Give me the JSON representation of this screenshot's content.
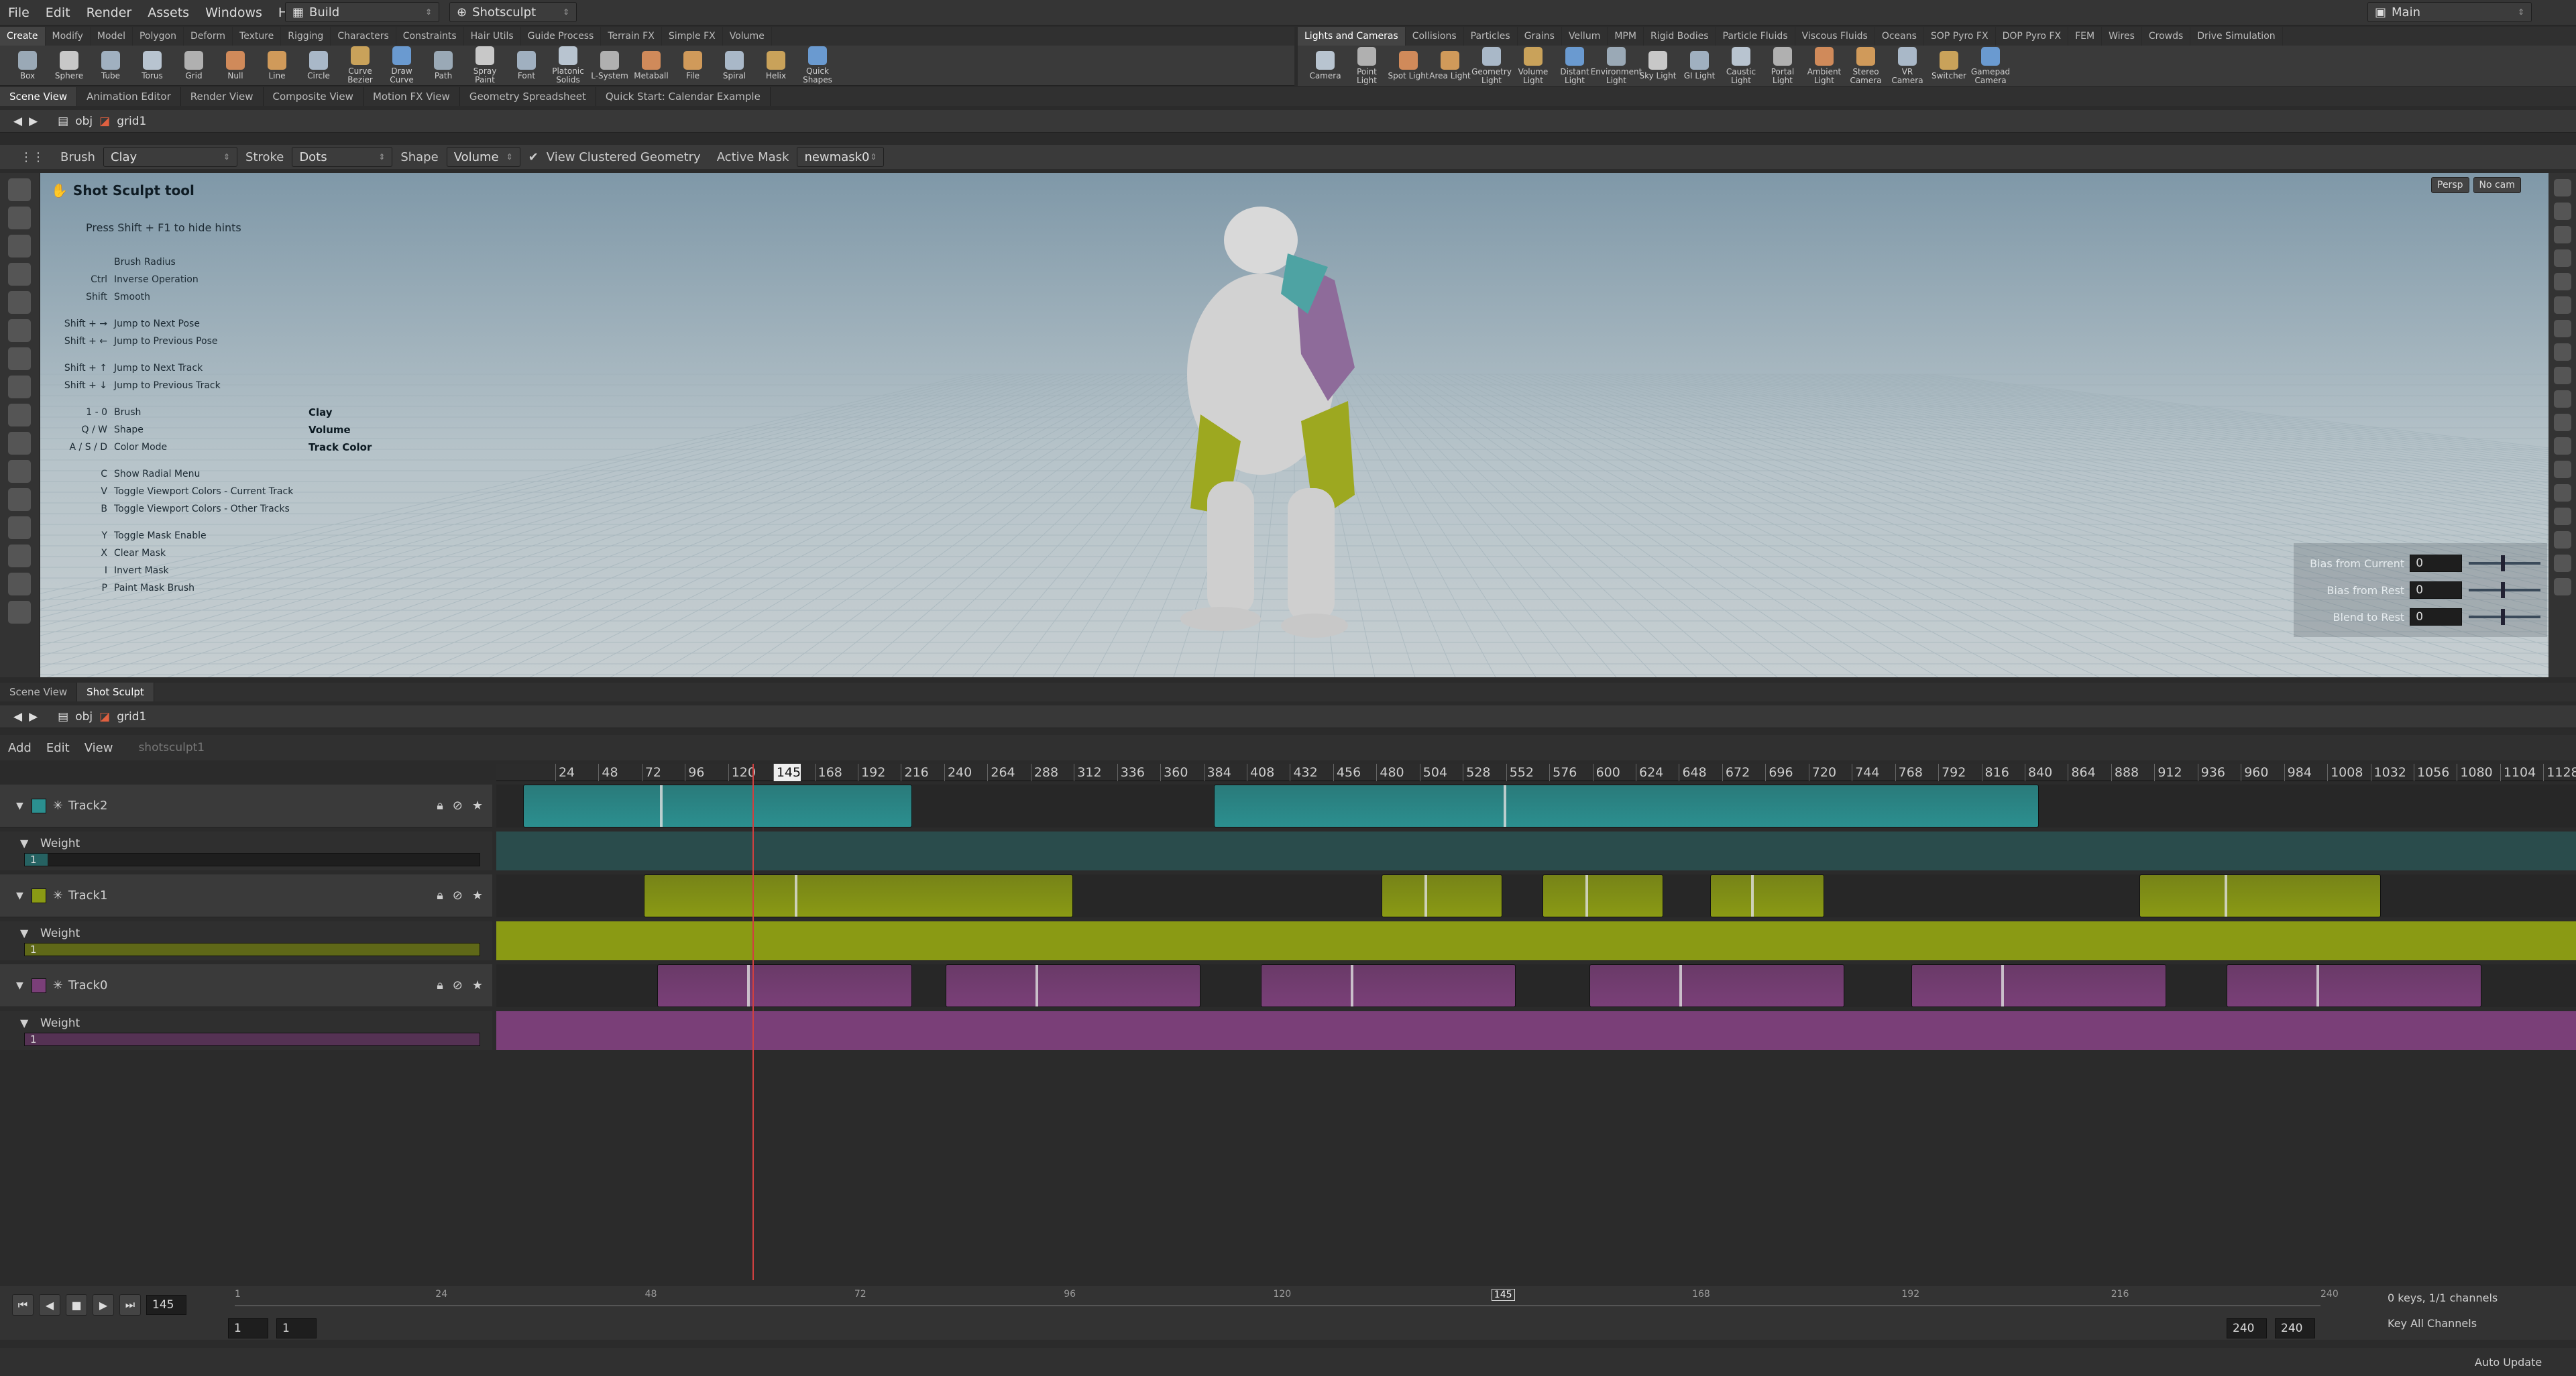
{
  "menu": [
    "File",
    "Edit",
    "Render",
    "Assets",
    "Windows",
    "Help"
  ],
  "desktop": "Build",
  "tool_combo": "Shotsculpt",
  "workspace": "Main",
  "shelf_tabs_left": [
    "Create",
    "Modify",
    "Model",
    "Polygon",
    "Deform",
    "Texture",
    "Rigging",
    "Characters",
    "Constraints",
    "Hair Utils",
    "Guide Process",
    "Terrain FX",
    "Simple FX",
    "Volume"
  ],
  "shelf_tabs_right": [
    "Lights and Cameras",
    "Collisions",
    "Particles",
    "Grains",
    "Vellum",
    "MPM",
    "Rigid Bodies",
    "Particle Fluids",
    "Viscous Fluids",
    "Oceans",
    "SOP Pyro FX",
    "DOP Pyro FX",
    "FEM",
    "Wires",
    "Crowds",
    "Drive Simulation"
  ],
  "tools_left": [
    "Box",
    "Sphere",
    "Tube",
    "Torus",
    "Grid",
    "Null",
    "Line",
    "Circle",
    "Curve Bezier",
    "Draw Curve",
    "Path",
    "Spray Paint",
    "Font",
    "Platonic Solids",
    "L-System",
    "Metaball",
    "File",
    "Spiral",
    "Helix",
    "Quick Shapes"
  ],
  "tools_right": [
    "Camera",
    "Point Light",
    "Spot Light",
    "Area Light",
    "Geometry Light",
    "Volume Light",
    "Distant Light",
    "Environment Light",
    "Sky Light",
    "GI Light",
    "Caustic Light",
    "Portal Light",
    "Ambient Light",
    "Stereo Camera",
    "VR Camera",
    "Switcher",
    "Gamepad Camera"
  ],
  "pane_tabs": [
    "Scene View",
    "Animation Editor",
    "Render View",
    "Composite View",
    "Motion FX View",
    "Geometry Spreadsheet",
    "Quick Start: Calendar Example"
  ],
  "path": {
    "obj": "obj",
    "node": "grid1"
  },
  "options": {
    "brush_label": "Brush",
    "brush": "Clay",
    "stroke_label": "Stroke",
    "stroke": "Dots",
    "shape_label": "Shape",
    "shape": "Volume",
    "clustered": "View Clustered Geometry",
    "mask_label": "Active Mask",
    "mask": "newmask0"
  },
  "viewport": {
    "persp": "Persp",
    "cam": "No cam",
    "title": "Shot Sculpt tool",
    "hint_line": "Press Shift + F1 to hide hints",
    "hints": [
      {
        "key": "",
        "text": "Brush Radius",
        "val": ""
      },
      {
        "key": "Ctrl",
        "text": "Inverse Operation",
        "val": ""
      },
      {
        "key": "Shift",
        "text": "Smooth",
        "val": ""
      },
      {
        "key": "Shift + →",
        "text": "Jump to Next Pose",
        "val": ""
      },
      {
        "key": "Shift + ←",
        "text": "Jump to Previous Pose",
        "val": ""
      },
      {
        "key": "Shift + ↑",
        "text": "Jump to Next Track",
        "val": ""
      },
      {
        "key": "Shift + ↓",
        "text": "Jump to Previous Track",
        "val": ""
      },
      {
        "key": "1 - 0",
        "text": "Brush",
        "val": "Clay"
      },
      {
        "key": "Q / W",
        "text": "Shape",
        "val": "Volume"
      },
      {
        "key": "A / S / D",
        "text": "Color Mode",
        "val": "Track Color"
      },
      {
        "key": "C",
        "text": "Show Radial Menu",
        "val": ""
      },
      {
        "key": "V",
        "text": "Toggle Viewport Colors - Current Track",
        "val": ""
      },
      {
        "key": "B",
        "text": "Toggle Viewport Colors - Other Tracks",
        "val": ""
      },
      {
        "key": "Y",
        "text": "Toggle Mask Enable",
        "val": ""
      },
      {
        "key": "X",
        "text": "Clear Mask",
        "val": ""
      },
      {
        "key": "I",
        "text": "Invert Mask",
        "val": ""
      },
      {
        "key": "P",
        "text": "Paint Mask Brush",
        "val": ""
      }
    ],
    "sliders": [
      {
        "label": "Bias from Current",
        "value": "0"
      },
      {
        "label": "Bias from Rest",
        "value": "0"
      },
      {
        "label": "Blend to Rest",
        "value": "0"
      }
    ]
  },
  "lower_tabs": [
    "Scene View",
    "Shot Sculpt"
  ],
  "timeline_menu": [
    "Add",
    "Edit",
    "View"
  ],
  "timeline_node": "shotsculpt1",
  "ruler": [
    "24",
    "48",
    "72",
    "96",
    "120",
    "145",
    "168",
    "192",
    "216",
    "240",
    "264",
    "288",
    "312",
    "336",
    "360",
    "384",
    "408",
    "432",
    "456",
    "480",
    "504",
    "528",
    "552",
    "576",
    "600",
    "624",
    "648",
    "672",
    "696",
    "720",
    "744",
    "768",
    "792",
    "816",
    "840",
    "864",
    "888",
    "912",
    "936",
    "960",
    "984",
    "1008",
    "1032",
    "1056",
    "1080",
    "1104",
    "1128"
  ],
  "tracks": [
    {
      "name": "Track2",
      "color": "#2b8f8f",
      "weight_label": "Weight",
      "weight": "1",
      "fill": 0.05
    },
    {
      "name": "Track1",
      "color": "#8a9a14",
      "weight_label": "Weight",
      "weight": "1",
      "fill": 1.0
    },
    {
      "name": "Track0",
      "color": "#7a3f78",
      "weight_label": "Weight",
      "weight": "1",
      "fill": 1.0
    }
  ],
  "playbar": {
    "frame": "145",
    "start": "1",
    "start2": "1",
    "end": "240",
    "end2": "240",
    "ticks": [
      "1",
      "24",
      "48",
      "72",
      "96",
      "120",
      "145",
      "168",
      "192",
      "216",
      "240"
    ],
    "keys": "0 keys, 1/1 channels",
    "key_all": "Key All Channels",
    "auto": "Auto Update"
  }
}
